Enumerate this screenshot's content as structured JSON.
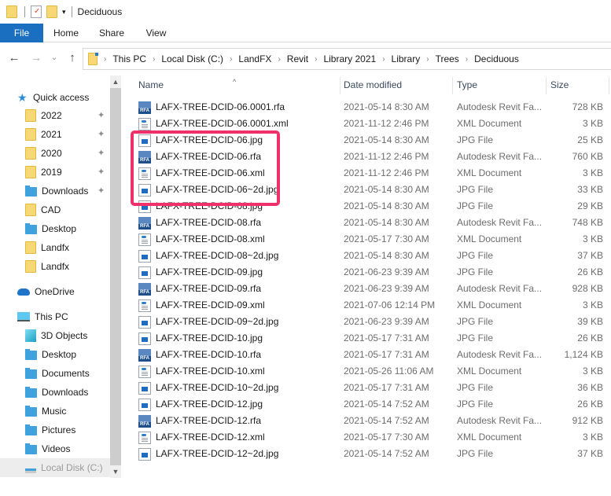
{
  "window": {
    "title": "Deciduous",
    "quick_access_toolbar": [
      "folder-properties-icon",
      "checkmark-document-icon",
      "new-folder-icon",
      "customize-dropdown-icon"
    ]
  },
  "ribbon": {
    "tabs": [
      "File",
      "Home",
      "Share",
      "View"
    ]
  },
  "navigation": {
    "back_icon": "←",
    "forward_icon": "→",
    "recent_icon": "⌄",
    "up_icon": "↑",
    "breadcrumb": [
      "This PC",
      "Local Disk (C:)",
      "LandFX",
      "Revit",
      "Library 2021",
      "Library",
      "Trees",
      "Deciduous"
    ],
    "separator": "›"
  },
  "sidebar": {
    "items": [
      {
        "label": "Quick access",
        "icon": "star-icon",
        "pinned": false
      },
      {
        "label": "2022",
        "icon": "folder-icon",
        "pinned": true
      },
      {
        "label": "2021",
        "icon": "folder-icon",
        "pinned": true
      },
      {
        "label": "2020",
        "icon": "folder-icon",
        "pinned": true
      },
      {
        "label": "2019",
        "icon": "folder-icon",
        "pinned": true
      },
      {
        "label": "Downloads",
        "icon": "downloads-folder-icon",
        "pinned": true
      },
      {
        "label": "CAD",
        "icon": "folder-icon",
        "pinned": false
      },
      {
        "label": "Desktop",
        "icon": "desktop-folder-icon",
        "pinned": false
      },
      {
        "label": "Landfx",
        "icon": "folder-icon",
        "pinned": false
      },
      {
        "label": "Landfx",
        "icon": "folder-icon",
        "pinned": false
      },
      {
        "label": "OneDrive",
        "icon": "cloud-icon",
        "pinned": false
      },
      {
        "label": "This PC",
        "icon": "computer-icon",
        "pinned": false
      },
      {
        "label": "3D Objects",
        "icon": "3d-objects-icon",
        "pinned": false
      },
      {
        "label": "Desktop",
        "icon": "desktop-folder-icon",
        "pinned": false
      },
      {
        "label": "Documents",
        "icon": "documents-folder-icon",
        "pinned": false
      },
      {
        "label": "Downloads",
        "icon": "downloads-folder-icon",
        "pinned": false
      },
      {
        "label": "Music",
        "icon": "music-folder-icon",
        "pinned": false
      },
      {
        "label": "Pictures",
        "icon": "pictures-folder-icon",
        "pinned": false
      },
      {
        "label": "Videos",
        "icon": "videos-folder-icon",
        "pinned": false
      },
      {
        "label": "Local Disk (C:)",
        "icon": "drive-icon",
        "pinned": false
      }
    ],
    "pin_glyph": "📌"
  },
  "columns": {
    "name": "Name",
    "date": "Date modified",
    "type": "Type",
    "size": "Size",
    "sort_indicator": "^"
  },
  "files": [
    {
      "name": "LAFX-TREE-DCID-06.0001.rfa",
      "kind": "rfa",
      "date": "2021-05-14 8:30 AM",
      "type": "Autodesk Revit Fa...",
      "size": "728 KB"
    },
    {
      "name": "LAFX-TREE-DCID-06.0001.xml",
      "kind": "xml",
      "date": "2021-11-12 2:46 PM",
      "type": "XML Document",
      "size": "3 KB"
    },
    {
      "name": "LAFX-TREE-DCID-06.jpg",
      "kind": "jpg",
      "date": "2021-05-14 8:30 AM",
      "type": "JPG File",
      "size": "25 KB"
    },
    {
      "name": "LAFX-TREE-DCID-06.rfa",
      "kind": "rfa",
      "date": "2021-11-12 2:46 PM",
      "type": "Autodesk Revit Fa...",
      "size": "760 KB"
    },
    {
      "name": "LAFX-TREE-DCID-06.xml",
      "kind": "xml",
      "date": "2021-11-12 2:46 PM",
      "type": "XML Document",
      "size": "3 KB"
    },
    {
      "name": "LAFX-TREE-DCID-06~2d.jpg",
      "kind": "jpg",
      "date": "2021-05-14 8:30 AM",
      "type": "JPG File",
      "size": "33 KB"
    },
    {
      "name": "LAFX-TREE-DCID-08.jpg",
      "kind": "jpg",
      "date": "2021-05-14 8:30 AM",
      "type": "JPG File",
      "size": "29 KB"
    },
    {
      "name": "LAFX-TREE-DCID-08.rfa",
      "kind": "rfa",
      "date": "2021-05-14 8:30 AM",
      "type": "Autodesk Revit Fa...",
      "size": "748 KB"
    },
    {
      "name": "LAFX-TREE-DCID-08.xml",
      "kind": "xml",
      "date": "2021-05-17 7:30 AM",
      "type": "XML Document",
      "size": "3 KB"
    },
    {
      "name": "LAFX-TREE-DCID-08~2d.jpg",
      "kind": "jpg",
      "date": "2021-05-14 8:30 AM",
      "type": "JPG File",
      "size": "37 KB"
    },
    {
      "name": "LAFX-TREE-DCID-09.jpg",
      "kind": "jpg",
      "date": "2021-06-23 9:39 AM",
      "type": "JPG File",
      "size": "26 KB"
    },
    {
      "name": "LAFX-TREE-DCID-09.rfa",
      "kind": "rfa",
      "date": "2021-06-23 9:39 AM",
      "type": "Autodesk Revit Fa...",
      "size": "928 KB"
    },
    {
      "name": "LAFX-TREE-DCID-09.xml",
      "kind": "xml",
      "date": "2021-07-06 12:14 PM",
      "type": "XML Document",
      "size": "3 KB"
    },
    {
      "name": "LAFX-TREE-DCID-09~2d.jpg",
      "kind": "jpg",
      "date": "2021-06-23 9:39 AM",
      "type": "JPG File",
      "size": "39 KB"
    },
    {
      "name": "LAFX-TREE-DCID-10.jpg",
      "kind": "jpg",
      "date": "2021-05-17 7:31 AM",
      "type": "JPG File",
      "size": "26 KB"
    },
    {
      "name": "LAFX-TREE-DCID-10.rfa",
      "kind": "rfa",
      "date": "2021-05-17 7:31 AM",
      "type": "Autodesk Revit Fa...",
      "size": "1,124 KB"
    },
    {
      "name": "LAFX-TREE-DCID-10.xml",
      "kind": "xml",
      "date": "2021-05-26 11:06 AM",
      "type": "XML Document",
      "size": "3 KB"
    },
    {
      "name": "LAFX-TREE-DCID-10~2d.jpg",
      "kind": "jpg",
      "date": "2021-05-17 7:31 AM",
      "type": "JPG File",
      "size": "36 KB"
    },
    {
      "name": "LAFX-TREE-DCID-12.jpg",
      "kind": "jpg",
      "date": "2021-05-14 7:52 AM",
      "type": "JPG File",
      "size": "26 KB"
    },
    {
      "name": "LAFX-TREE-DCID-12.rfa",
      "kind": "rfa",
      "date": "2021-05-14 7:52 AM",
      "type": "Autodesk Revit Fa...",
      "size": "912 KB"
    },
    {
      "name": "LAFX-TREE-DCID-12.xml",
      "kind": "xml",
      "date": "2021-05-17 7:30 AM",
      "type": "XML Document",
      "size": "3 KB"
    },
    {
      "name": "LAFX-TREE-DCID-12~2d.jpg",
      "kind": "jpg",
      "date": "2021-05-14 7:52 AM",
      "type": "JPG File",
      "size": "37 KB"
    }
  ],
  "annotation": {
    "highlight_color": "#f0306a",
    "highlighted_files": [
      "LAFX-TREE-DCID-06.jpg",
      "LAFX-TREE-DCID-06.rfa",
      "LAFX-TREE-DCID-06.xml",
      "LAFX-TREE-DCID-06~2d.jpg"
    ]
  },
  "colors": {
    "file_tab": "#1a6fc1",
    "folder": "#f8d775",
    "library_folder": "#3fa1de"
  }
}
